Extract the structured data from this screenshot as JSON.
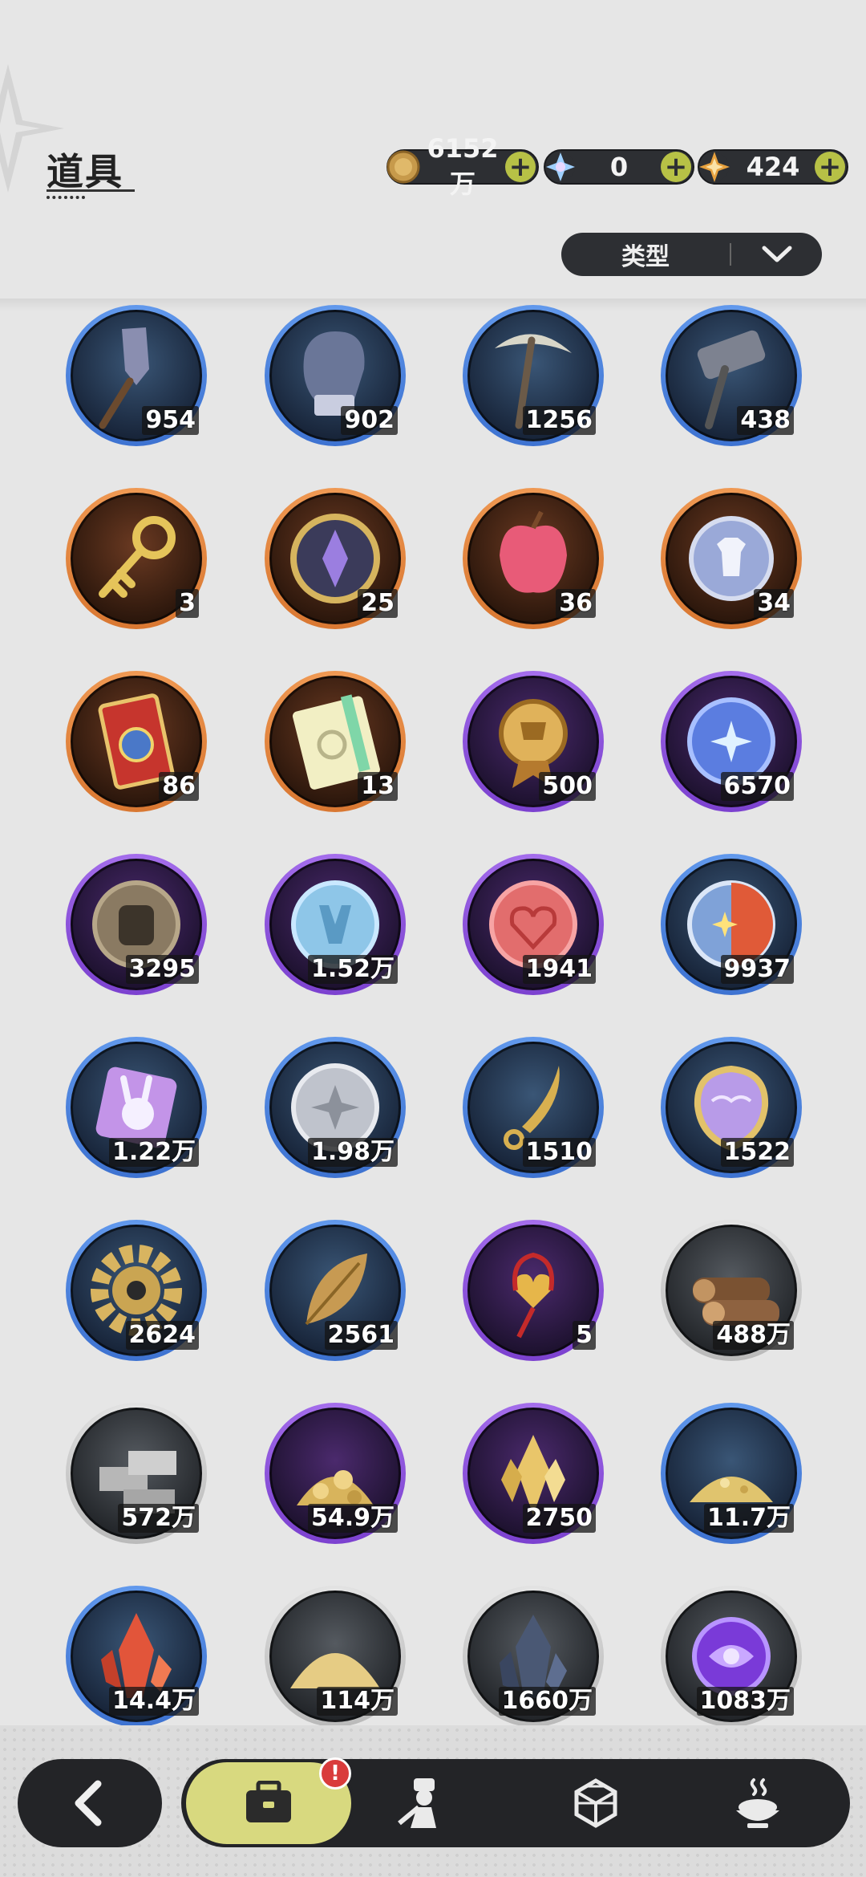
{
  "header": {
    "title": "道具",
    "currencies": [
      {
        "name": "gold-coin",
        "value": "6152万",
        "color": "#c79a4b"
      },
      {
        "name": "crystal",
        "value": "0",
        "color": "#9fd0ff"
      },
      {
        "name": "star-gem",
        "value": "424",
        "color": "#e7a13e"
      }
    ],
    "filter_label": "类型"
  },
  "items": [
    {
      "icon": "shovel-icon",
      "count": "954",
      "rarity": "blue"
    },
    {
      "icon": "boxing-glove-icon",
      "count": "902",
      "rarity": "blue"
    },
    {
      "icon": "pickaxe-icon",
      "count": "1256",
      "rarity": "blue"
    },
    {
      "icon": "hammer-icon",
      "count": "438",
      "rarity": "blue"
    },
    {
      "icon": "golden-key-icon",
      "count": "3",
      "rarity": "orange"
    },
    {
      "icon": "emblem-icon",
      "count": "25",
      "rarity": "orange"
    },
    {
      "icon": "crystal-apple-icon",
      "count": "36",
      "rarity": "orange"
    },
    {
      "icon": "outfit-token-icon",
      "count": "34",
      "rarity": "orange"
    },
    {
      "icon": "red-ticket-icon",
      "count": "86",
      "rarity": "orange"
    },
    {
      "icon": "rainbow-ticket-icon",
      "count": "13",
      "rarity": "orange"
    },
    {
      "icon": "trophy-medal-icon",
      "count": "500",
      "rarity": "purple"
    },
    {
      "icon": "star-coin-icon",
      "count": "6570",
      "rarity": "purple"
    },
    {
      "icon": "fist-coin-icon",
      "count": "3295",
      "rarity": "purple"
    },
    {
      "icon": "blue-coin-icon",
      "count": "1.52万",
      "rarity": "purple"
    },
    {
      "icon": "heart-coin-icon",
      "count": "1941",
      "rarity": "purple"
    },
    {
      "icon": "sun-moon-coin-icon",
      "count": "9937",
      "rarity": "blue"
    },
    {
      "icon": "bunny-badge-icon",
      "count": "1.22万",
      "rarity": "blue"
    },
    {
      "icon": "silver-coin-icon",
      "count": "1.98万",
      "rarity": "blue"
    },
    {
      "icon": "golden-blade-icon",
      "count": "1510",
      "rarity": "blue"
    },
    {
      "icon": "scale-shield-icon",
      "count": "1522",
      "rarity": "blue"
    },
    {
      "icon": "gear-icon",
      "count": "2624",
      "rarity": "blue"
    },
    {
      "icon": "golden-leaf-icon",
      "count": "2561",
      "rarity": "blue"
    },
    {
      "icon": "heart-charm-icon",
      "count": "5",
      "rarity": "purple"
    },
    {
      "icon": "wood-logs-icon",
      "count": "488万",
      "rarity": "gray"
    },
    {
      "icon": "stone-bricks-icon",
      "count": "572万",
      "rarity": "gray"
    },
    {
      "icon": "gold-ore-icon",
      "count": "54.9万",
      "rarity": "purple"
    },
    {
      "icon": "gold-crystal-icon",
      "count": "2750",
      "rarity": "purple"
    },
    {
      "icon": "gold-sand-icon",
      "count": "11.7万",
      "rarity": "blue"
    },
    {
      "icon": "red-crystal-icon",
      "count": "14.4万",
      "rarity": "blue"
    },
    {
      "icon": "sand-pile-icon",
      "count": "114万",
      "rarity": "gray"
    },
    {
      "icon": "dark-crystal-icon",
      "count": "1660万",
      "rarity": "gray"
    },
    {
      "icon": "purple-orb-icon",
      "count": "1083万",
      "rarity": "gray"
    }
  ],
  "nav": {
    "badge": "!",
    "tabs": [
      {
        "icon": "bag-icon",
        "active": true
      },
      {
        "icon": "character-icon",
        "active": false
      },
      {
        "icon": "hexagon-gem-icon",
        "active": false
      },
      {
        "icon": "cooking-icon",
        "active": false
      }
    ]
  }
}
